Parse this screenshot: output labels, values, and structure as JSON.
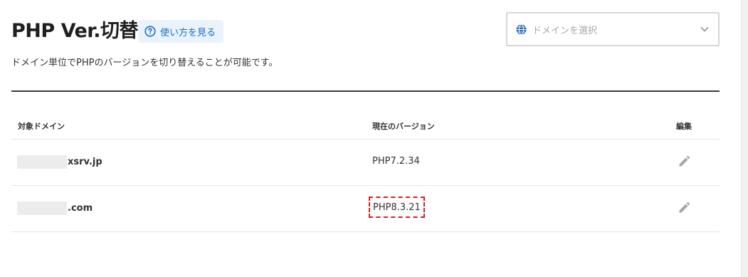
{
  "page": {
    "title": "PHP Ver.切替",
    "help_label": "使い方を見る",
    "description": "ドメイン単位でPHPのバージョンを切り替えることが可能です。"
  },
  "domain_select": {
    "placeholder": "ドメインを選択"
  },
  "table": {
    "headers": {
      "domain": "対象ドメイン",
      "version": "現在のバージョン",
      "edit": "編集"
    },
    "rows": [
      {
        "domain_suffix": "xsrv.jp",
        "version": "PHP7.2.34",
        "highlighted": false
      },
      {
        "domain_suffix": ".com",
        "version": "PHP8.3.21",
        "highlighted": true
      }
    ]
  },
  "colors": {
    "accent": "#1a6fbf",
    "highlight_border": "#d91c1c",
    "divider": "#3a3a3a"
  },
  "icons": {
    "help": "question-circle-icon",
    "domain": "globe-icon",
    "dropdown": "chevron-down-icon",
    "edit": "pencil-icon"
  }
}
